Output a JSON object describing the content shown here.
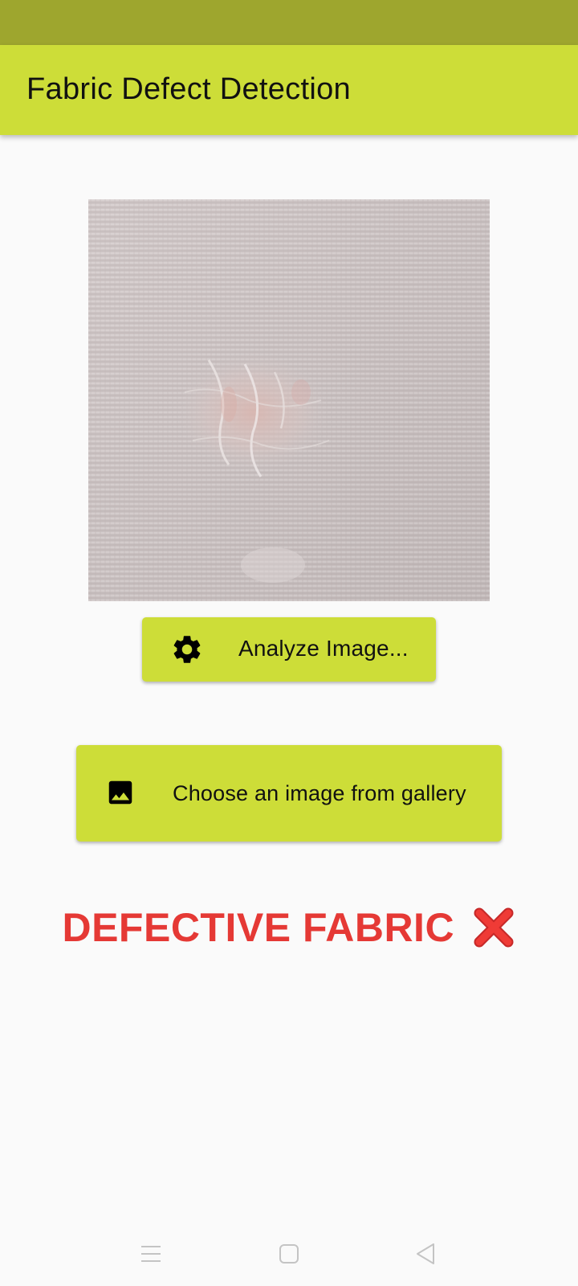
{
  "app_bar": {
    "title": "Fabric Defect Detection"
  },
  "preview": {
    "icon": "fabric-image"
  },
  "analyze_button": {
    "label": "Analyze Image...",
    "icon": "gear-icon"
  },
  "gallery_button": {
    "label": "Choose an image from gallery",
    "icon": "image-icon"
  },
  "result": {
    "text": "DEFECTIVE FABRIC",
    "icon": "cross-mark-icon",
    "color": "#e53935"
  },
  "nav_bar": {
    "icons": [
      "menu-icon",
      "home-icon",
      "back-icon"
    ]
  },
  "colors": {
    "status_bar": "#9ea62e",
    "accent": "#cddd38",
    "background": "#fafafa"
  }
}
